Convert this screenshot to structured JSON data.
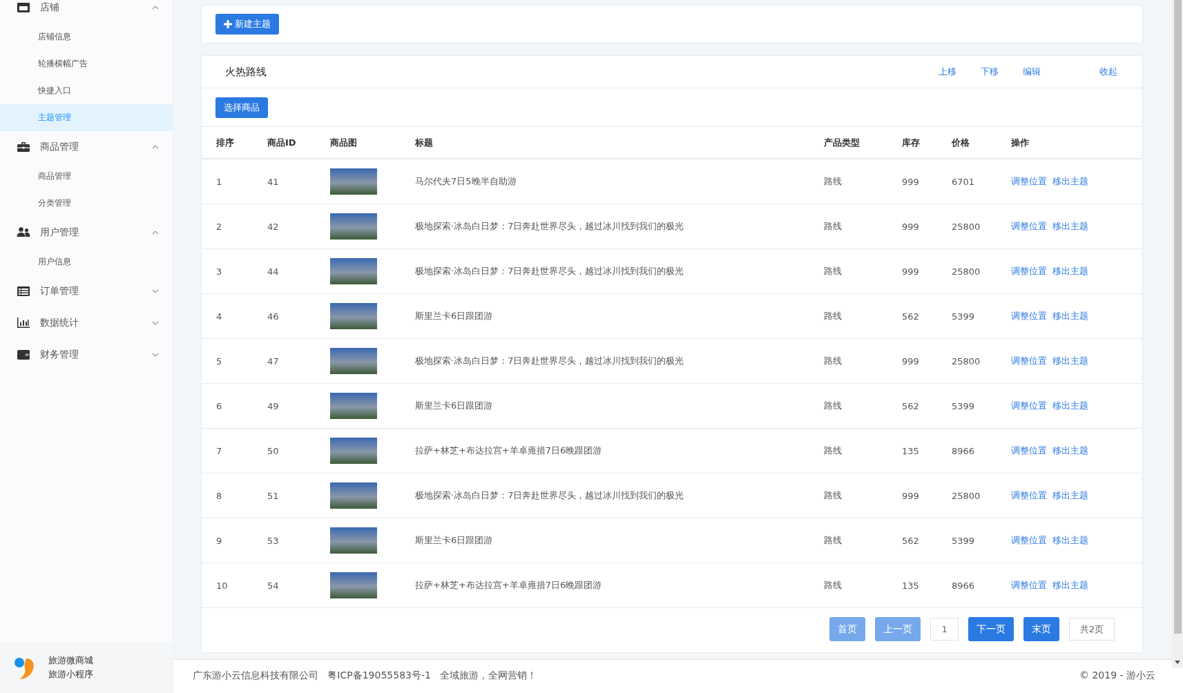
{
  "sidebar": {
    "groups": [
      {
        "kind": "store",
        "label": "店铺",
        "expanded": true,
        "children": [
          {
            "label": "店铺信息",
            "selected": false
          },
          {
            "label": "轮播横幅广告",
            "selected": false
          },
          {
            "label": "快捷入口",
            "selected": false
          },
          {
            "label": "主题管理",
            "selected": true
          }
        ]
      },
      {
        "kind": "toolbox",
        "label": "商品管理",
        "expanded": true,
        "children": [
          {
            "label": "商品管理",
            "selected": false
          },
          {
            "label": "分类管理",
            "selected": false
          }
        ]
      },
      {
        "kind": "users",
        "label": "用户管理",
        "expanded": true,
        "children": [
          {
            "label": "用户信息",
            "selected": false
          }
        ]
      },
      {
        "kind": "list",
        "label": "订单管理",
        "expanded": false
      },
      {
        "kind": "chart",
        "label": "数据统计",
        "expanded": false
      },
      {
        "kind": "wallet",
        "label": "财务管理",
        "expanded": false
      }
    ],
    "brand": {
      "line_1": "旅游微商城",
      "line_2": "旅游小程序"
    }
  },
  "new_theme_button": "新建主题",
  "theme": {
    "title": "火热路线",
    "actions": [
      "上移",
      "下移",
      "编辑",
      "收起"
    ],
    "select_button": "选择商品",
    "columns": [
      "排序",
      "商品ID",
      "商品图",
      "标题",
      "产品类型",
      "库存",
      "价格",
      "操作"
    ],
    "rows": [
      {
        "order": "1",
        "id": "41",
        "title": "马尔代夫7日5晚半自助游",
        "type": "路线",
        "stock": "999",
        "price": "6701",
        "ops": [
          "调整位置",
          "移出主题"
        ]
      },
      {
        "order": "2",
        "id": "42",
        "title": "极地探索·冰岛白日梦：7日奔赴世界尽头，越过冰川找到我们的极光",
        "type": "路线",
        "stock": "999",
        "price": "25800",
        "ops": [
          "调整位置",
          "移出主题"
        ]
      },
      {
        "order": "3",
        "id": "44",
        "title": "极地探索·冰岛白日梦：7日奔赴世界尽头，越过冰川找到我们的极光",
        "type": "路线",
        "stock": "999",
        "price": "25800",
        "ops": [
          "调整位置",
          "移出主题"
        ]
      },
      {
        "order": "4",
        "id": "46",
        "title": "斯里兰卡6日跟团游",
        "type": "路线",
        "stock": "562",
        "price": "5399",
        "ops": [
          "调整位置",
          "移出主题"
        ]
      },
      {
        "order": "5",
        "id": "47",
        "title": "极地探索·冰岛白日梦：7日奔赴世界尽头，越过冰川找到我们的极光",
        "type": "路线",
        "stock": "999",
        "price": "25800",
        "ops": [
          "调整位置",
          "移出主题"
        ]
      },
      {
        "order": "6",
        "id": "49",
        "title": "斯里兰卡6日跟团游",
        "type": "路线",
        "stock": "562",
        "price": "5399",
        "ops": [
          "调整位置",
          "移出主题"
        ]
      },
      {
        "order": "7",
        "id": "50",
        "title": "拉萨+林芝+布达拉宫+羊卓雍措7日6晚跟团游",
        "type": "路线",
        "stock": "135",
        "price": "8966",
        "ops": [
          "调整位置",
          "移出主题"
        ]
      },
      {
        "order": "8",
        "id": "51",
        "title": "极地探索·冰岛白日梦：7日奔赴世界尽头，越过冰川找到我们的极光",
        "type": "路线",
        "stock": "999",
        "price": "25800",
        "ops": [
          "调整位置",
          "移出主题"
        ]
      },
      {
        "order": "9",
        "id": "53",
        "title": "斯里兰卡6日跟团游",
        "type": "路线",
        "stock": "562",
        "price": "5399",
        "ops": [
          "调整位置",
          "移出主题"
        ]
      },
      {
        "order": "10",
        "id": "54",
        "title": "拉萨+林芝+布达拉宫+羊卓雍措7日6晚跟团游",
        "type": "路线",
        "stock": "135",
        "price": "8966",
        "ops": [
          "调整位置",
          "移出主题"
        ]
      }
    ]
  },
  "pagination": {
    "buttons": [
      {
        "label": "首页",
        "disabled": true
      },
      {
        "label": "上一页",
        "disabled": true
      }
    ],
    "current": "1",
    "next_buttons": [
      {
        "label": "下一页",
        "disabled": false
      },
      {
        "label": "末页",
        "disabled": false
      }
    ],
    "total": "共2页"
  },
  "footer": {
    "left": "广东游小云信息科技有限公司   粤ICP备19055583号-1   全域旅游，全网营销！",
    "right": "© 2019 - 游小云"
  }
}
